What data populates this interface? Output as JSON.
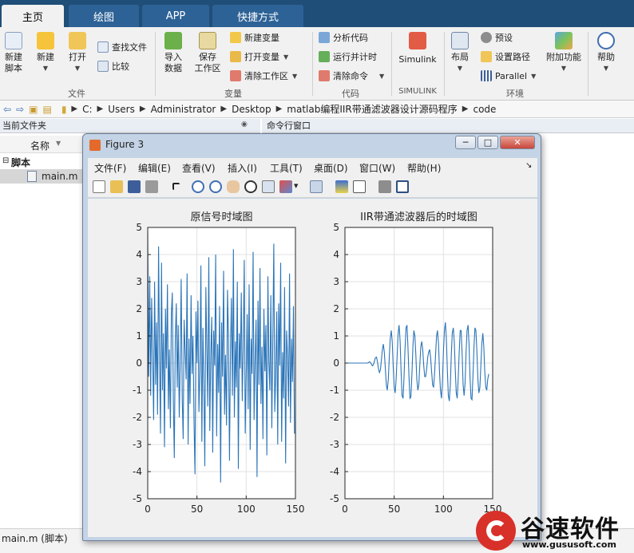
{
  "tabs": [
    "主页",
    "绘图",
    "APP",
    "快捷方式"
  ],
  "ribbon": {
    "file_group": {
      "label": "文件",
      "new_script": "新建\n脚本",
      "new": "新建",
      "open": "打开",
      "find_files": "查找文件",
      "compare": "比较"
    },
    "variable_group": {
      "label": "变量",
      "import": "导入\n数据",
      "save_ws": "保存\n工作区",
      "new_var": "新建变量",
      "open_var": "打开变量",
      "clear_ws": "清除工作区"
    },
    "code_group": {
      "label": "代码",
      "analyze": "分析代码",
      "run_time": "运行并计时",
      "clear_cmd": "清除命令"
    },
    "simulink_group": {
      "label": "SIMULINK",
      "simulink": "Simulink"
    },
    "env_group": {
      "label": "环境",
      "layout": "布局",
      "prefs": "预设",
      "set_path": "设置路径",
      "parallel": "Parallel",
      "addons": "附加功能"
    },
    "help": "帮助"
  },
  "address": [
    "C:",
    "Users",
    "Administrator",
    "Desktop",
    "matlab编程IIR带通滤波器设计源码程序",
    "code"
  ],
  "file_panel": {
    "title": "当前文件夹",
    "col_name": "名称",
    "folder": "脚本",
    "file": "main.m"
  },
  "command_window_title": "命令行窗口",
  "status": "main.m  (脚本)",
  "figure": {
    "title": "Figure 3",
    "menu": [
      "文件(F)",
      "编辑(E)",
      "查看(V)",
      "插入(I)",
      "工具(T)",
      "桌面(D)",
      "窗口(W)",
      "帮助(H)"
    ]
  },
  "watermark": {
    "brand": "谷速软件",
    "url": "www.gususoft.com"
  },
  "chart_data": [
    {
      "type": "line",
      "title": "原信号时域图",
      "xlabel": "",
      "ylabel": "",
      "xlim": [
        0,
        150
      ],
      "ylim": [
        -5,
        5
      ],
      "xticks": [
        0,
        50,
        100,
        150
      ],
      "yticks": [
        -5,
        -4,
        -3,
        -2,
        -1,
        0,
        1,
        2,
        3,
        4,
        5
      ],
      "grid": true,
      "color": "#2a74b8",
      "series": [
        {
          "x_start": 0,
          "x_step": 1,
          "values": [
            4.8,
            -0.5,
            3.2,
            -1.2,
            2.4,
            0.3,
            -2.1,
            3.0,
            -0.8,
            1.5,
            -1.9,
            4.3,
            0.2,
            -2.6,
            3.7,
            -1.0,
            1.1,
            -3.1,
            2.0,
            -0.2,
            2.9,
            -1.7,
            0.5,
            -2.4,
            1.8,
            2.6,
            -1.4,
            -3.5,
            0.8,
            2.2,
            -0.9,
            1.4,
            -2.0,
            0.1,
            3.1,
            -1.3,
            -2.8,
            1.6,
            0.4,
            -0.6,
            3.3,
            -3.0,
            0.9,
            -1.5,
            2.5,
            -0.4,
            1.0,
            -2.2,
            -4.1,
            1.9,
            0.0,
            2.3,
            -1.8,
            -0.3,
            3.6,
            -2.9,
            1.3,
            -0.7,
            -3.8,
            2.8,
            0.6,
            -1.6,
            3.9,
            -2.5,
            0.2,
            1.7,
            -3.3,
            1.2,
            -0.1,
            4.0,
            -2.7,
            0.7,
            -1.1,
            2.1,
            -4.4,
            1.5,
            -0.5,
            3.4,
            -1.9,
            0.3,
            -2.3,
            2.7,
            1.0,
            -3.6,
            0.4,
            2.4,
            -1.2,
            4.2,
            -2.0,
            0.8,
            -0.9,
            3.0,
            -3.9,
            1.1,
            -0.2,
            2.6,
            -1.4,
            0.5,
            3.8,
            -2.6,
            -0.6,
            1.8,
            -1.7,
            2.9,
            -3.2,
            0.9,
            -0.4,
            4.1,
            -2.1,
            0.0,
            1.6,
            -4.2,
            2.3,
            -0.8,
            3.5,
            -1.5,
            0.6,
            -2.8,
            2.0,
            -0.3,
            1.4,
            -3.4,
            3.2,
            0.1,
            -1.0,
            2.5,
            -2.4,
            0.7,
            4.4,
            -1.8,
            -0.5,
            1.9,
            -3.0,
            2.2,
            -0.1,
            3.7,
            -2.9,
            0.4,
            -1.3,
            2.8,
            -3.7,
            1.2,
            0.3,
            -1.6,
            3.3,
            -2.2,
            0.9,
            -0.7,
            2.1,
            -2.6
          ]
        }
      ]
    },
    {
      "type": "line",
      "title": "IIR带通滤波器后的时域图",
      "xlabel": "",
      "ylabel": "",
      "xlim": [
        0,
        150
      ],
      "ylim": [
        -5,
        5
      ],
      "xticks": [
        0,
        50,
        100,
        150
      ],
      "yticks": [
        -5,
        -4,
        -3,
        -2,
        -1,
        0,
        1,
        2,
        3,
        4,
        5
      ],
      "grid": true,
      "color": "#2a74b8",
      "series": [
        {
          "x_start": 0,
          "x_step": 1,
          "values": [
            0,
            0,
            0,
            0,
            0,
            0,
            0,
            0,
            0,
            0,
            0,
            0,
            0,
            0,
            0,
            0,
            0,
            0,
            0,
            0,
            0,
            0,
            0,
            0,
            0.02,
            0.05,
            0.02,
            -0.05,
            -0.1,
            -0.05,
            0.08,
            0.2,
            0.22,
            0.05,
            -0.2,
            -0.35,
            -0.25,
            0.1,
            0.5,
            0.7,
            0.4,
            -0.2,
            -0.8,
            -1.0,
            -0.6,
            0.2,
            0.9,
            1.2,
            0.8,
            -0.1,
            -0.9,
            -1.1,
            -0.6,
            0.3,
            1.1,
            1.4,
            0.8,
            -0.3,
            -1.2,
            -1.3,
            -0.5,
            0.5,
            1.3,
            1.4,
            0.6,
            -0.5,
            -1.3,
            -1.25,
            -0.4,
            0.6,
            1.2,
            1.0,
            0.3,
            -0.6,
            -1.0,
            -0.8,
            -0.1,
            0.6,
            0.8,
            0.5,
            -0.1,
            -0.5,
            -0.5,
            -0.2,
            0.2,
            0.4,
            0.5,
            0.2,
            -0.3,
            -0.8,
            -0.9,
            -0.4,
            0.3,
            1.0,
            1.2,
            0.7,
            -0.3,
            -1.0,
            -1.3,
            -0.7,
            0.4,
            1.2,
            1.5,
            0.9,
            -0.3,
            -1.2,
            -1.4,
            -0.8,
            0.3,
            1.1,
            1.3,
            0.8,
            -0.2,
            -1.1,
            -1.3,
            -0.6,
            0.4,
            1.2,
            1.2,
            0.3,
            -0.8,
            -1.2,
            -0.7,
            0.4,
            1.2,
            1.4,
            0.7,
            -0.5,
            -1.3,
            -1.35,
            -0.5,
            0.6,
            1.3,
            1.2,
            0.4,
            -0.6,
            -1.1,
            -0.9,
            -0.1,
            0.7,
            1.1,
            0.6,
            -0.3,
            -0.9,
            -1.0,
            -0.6,
            -0.4
          ]
        }
      ]
    }
  ]
}
